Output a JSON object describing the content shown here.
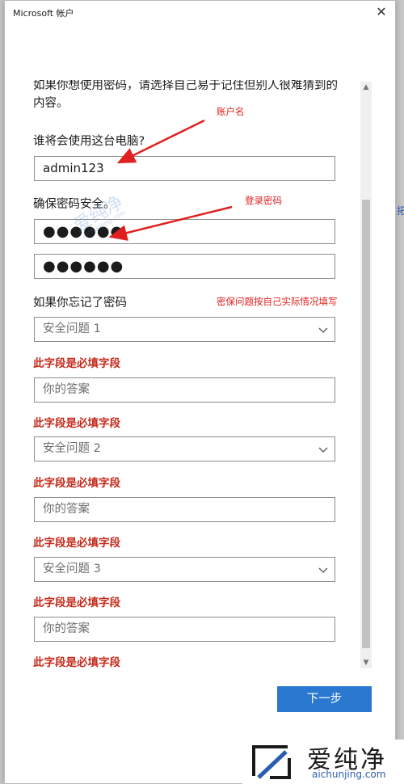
{
  "window": {
    "title": "Microsoft 帐户"
  },
  "form": {
    "intro": "如果你想使用密码，请选择自己易于记住但别人很难猜到的内容。",
    "user_label": "谁将会使用这台电脑?",
    "username_value": "admin123",
    "password_label": "确保密码安全。",
    "password_value": "●●●●●●",
    "password_confirm_value": "●●●●●●",
    "forgot_label": "如果你忘记了密码",
    "question1": "安全问题 1",
    "question2": "安全问题 2",
    "question3": "安全问题 3",
    "answer_placeholder": "你的答案",
    "required_error": "此字段是必填字段",
    "next_button": "下一步"
  },
  "annotations": {
    "username": "账户名",
    "password": "登录密码",
    "security": "密保问题按自己实际情况填写"
  },
  "watermark": {
    "brand": "爱纯净",
    "url": "aichunjing.com"
  },
  "colors": {
    "accent": "#2b78d0",
    "error": "#c42b1c",
    "annotation": "#e02020"
  }
}
